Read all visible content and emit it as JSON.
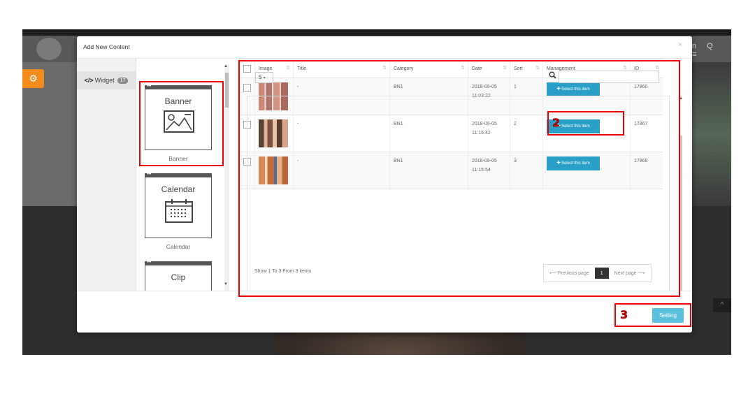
{
  "background_site": {
    "nav_icons": "n Q ≡",
    "settings_icon": "gears-icon",
    "scroll_top": "^"
  },
  "modal": {
    "title": "Add New Content",
    "close": "×",
    "tab": {
      "tag": "</>",
      "label": "Widget",
      "badge": "17"
    },
    "widgets": [
      {
        "title": "Banner",
        "caption": "Banner",
        "icon": "image-icon"
      },
      {
        "title": "Calendar",
        "caption": "Calendar",
        "icon": "calendar-icon"
      },
      {
        "title": "Clip",
        "caption": "",
        "icon": "clip-icon"
      }
    ],
    "table": {
      "length_value": "5",
      "search_placeholder": "",
      "columns": [
        "Image",
        "Title",
        "Category",
        "Date",
        "Sort",
        "Management",
        "ID"
      ],
      "rows": [
        {
          "title": "-",
          "category": "BN1",
          "date": "2018-09-05",
          "time": "11:03:22",
          "sort": "1",
          "action": "Select this item",
          "id": "17860"
        },
        {
          "title": "-",
          "category": "BN1",
          "date": "2018-09-05",
          "time": "11:15:42",
          "sort": "2",
          "action": "Select this item",
          "id": "17867"
        },
        {
          "title": "-",
          "category": "BN1",
          "date": "2018-09-05",
          "time": "11:15:54",
          "sort": "3",
          "action": "Select this item",
          "id": "17868"
        }
      ],
      "info": "Show 1 To 3 From 3 items",
      "pager": {
        "prev": "⟵ Previous page",
        "current": "1",
        "next": "Next page ⟶"
      }
    },
    "footer": {
      "setting_label": "Setting"
    }
  },
  "annotations": {
    "step2": "2",
    "step3": "3",
    "color": "#e00000"
  }
}
